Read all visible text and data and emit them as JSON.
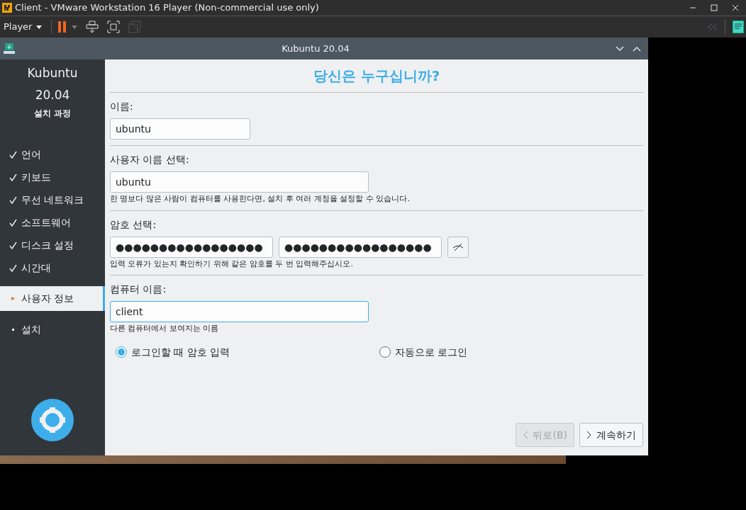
{
  "host_window": {
    "title": "Client - VMware Workstation 16 Player (Non-commercial use only)"
  },
  "host_toolbar": {
    "player_menu": "Player"
  },
  "installer": {
    "title": "Kubuntu 20.04",
    "sidebar": {
      "product": "Kubuntu",
      "version": "20.04",
      "subtitle": "설치 과정",
      "steps": [
        {
          "label": "언어",
          "kind": "done",
          "selected": false
        },
        {
          "label": "키보드",
          "kind": "done",
          "selected": false
        },
        {
          "label": "무선 네트워크",
          "kind": "done",
          "selected": false
        },
        {
          "label": "소프트웨어",
          "kind": "done",
          "selected": false
        },
        {
          "label": "디스크 설정",
          "kind": "done",
          "selected": false
        },
        {
          "label": "시간대",
          "kind": "done",
          "selected": false
        },
        {
          "label": "사용자 정보",
          "kind": "current",
          "selected": true
        },
        {
          "label": "설치",
          "kind": "pending",
          "selected": false
        }
      ]
    },
    "heading": "당신은 누구십니까?",
    "name": {
      "label": "이름:",
      "value": "ubuntu"
    },
    "username": {
      "label": "사용자 이름 선택:",
      "value": "ubuntu",
      "hint": "한 명보다 많은 사람이 컴퓨터를 사용한다면, 설치 후 여러 계정을 설정할 수 있습니다."
    },
    "password": {
      "label": "암호 선택:",
      "value": "●●●●●●●●●●●●●●●●●",
      "confirm_value": "●●●●●●●●●●●●●●●●●",
      "hint": "입력 오류가 있는지 확인하기 위해 같은 암호를 두 번 입력해주십시오."
    },
    "computer_name": {
      "label": "컴퓨터 이름:",
      "value": "client",
      "focused": true,
      "hint": "다른 컴퓨터에서 보여지는 이름"
    },
    "login_options": [
      {
        "label": "로그인할 때 암호 입력",
        "selected": true
      },
      {
        "label": "자동으로 로그인",
        "selected": false
      }
    ],
    "buttons": [
      {
        "label": "뒤로(B)",
        "kind": "back",
        "disabled": true
      },
      {
        "label": "계속하기",
        "kind": "next",
        "disabled": false
      }
    ]
  }
}
